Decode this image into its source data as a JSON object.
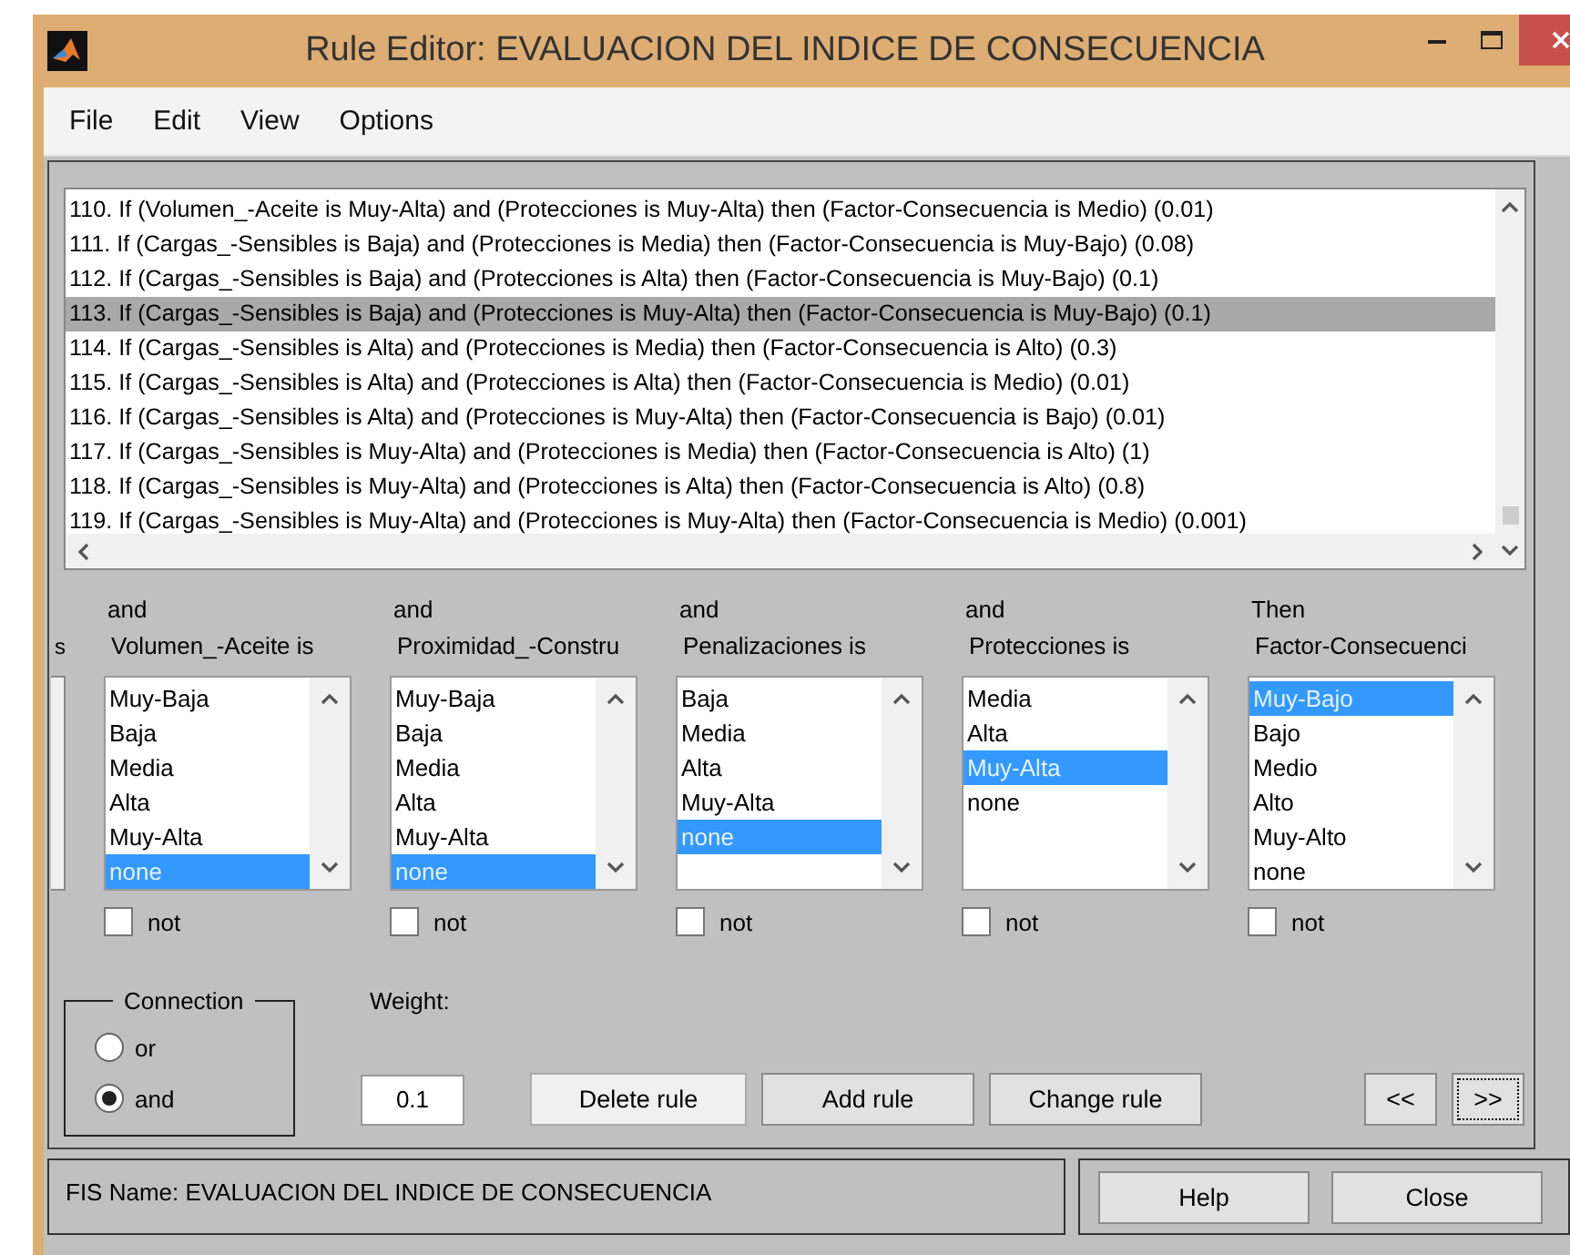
{
  "window": {
    "title": "Rule Editor: EVALUACION DEL INDICE DE CONSECUENCIA"
  },
  "menu": [
    "File",
    "Edit",
    "View",
    "Options"
  ],
  "rules": [
    {
      "text": "110. If (Volumen_-Aceite is Muy-Alta) and (Protecciones is Muy-Alta) then (Factor-Consecuencia is Medio) (0.01)",
      "selected": false
    },
    {
      "text": "111. If (Cargas_-Sensibles is Baja) and (Protecciones is Media) then (Factor-Consecuencia is Muy-Bajo) (0.08)",
      "selected": false
    },
    {
      "text": "112. If (Cargas_-Sensibles is Baja) and (Protecciones is Alta) then (Factor-Consecuencia is Muy-Bajo) (0.1)",
      "selected": false
    },
    {
      "text": "113. If (Cargas_-Sensibles is Baja) and (Protecciones is Muy-Alta) then (Factor-Consecuencia is Muy-Bajo) (0.1)",
      "selected": true
    },
    {
      "text": "114. If (Cargas_-Sensibles is Alta) and (Protecciones is Media) then (Factor-Consecuencia is Alto) (0.3)",
      "selected": false
    },
    {
      "text": "115. If (Cargas_-Sensibles is Alta) and (Protecciones is Alta) then (Factor-Consecuencia is Medio) (0.01)",
      "selected": false
    },
    {
      "text": "116. If (Cargas_-Sensibles is Alta) and (Protecciones is Muy-Alta) then (Factor-Consecuencia is Bajo) (0.01)",
      "selected": false
    },
    {
      "text": "117. If (Cargas_-Sensibles is Muy-Alta) and (Protecciones is Media) then (Factor-Consecuencia is Alto) (1)",
      "selected": false
    },
    {
      "text": "118. If (Cargas_-Sensibles is Muy-Alta) and (Protecciones is Alta) then (Factor-Consecuencia is Alto) (0.8)",
      "selected": false
    },
    {
      "text": "119. If (Cargas_-Sensibles is Muy-Alta) and (Protecciones is Muy-Alta) then (Factor-Consecuencia is Medio) (0.001)",
      "selected": false
    }
  ],
  "partial_column": {
    "label": "s"
  },
  "columns": [
    {
      "connector": "and",
      "label": "Volumen_-Aceite is",
      "not": false,
      "items": [
        {
          "label": "Muy-Baja",
          "selected": false
        },
        {
          "label": "Baja",
          "selected": false
        },
        {
          "label": "Media",
          "selected": false
        },
        {
          "label": "Alta",
          "selected": false
        },
        {
          "label": "Muy-Alta",
          "selected": false
        },
        {
          "label": "none",
          "selected": true
        }
      ]
    },
    {
      "connector": "and",
      "label": "Proximidad_-Constru",
      "not": false,
      "items": [
        {
          "label": "Muy-Baja",
          "selected": false
        },
        {
          "label": "Baja",
          "selected": false
        },
        {
          "label": "Media",
          "selected": false
        },
        {
          "label": "Alta",
          "selected": false
        },
        {
          "label": "Muy-Alta",
          "selected": false
        },
        {
          "label": "none",
          "selected": true
        }
      ]
    },
    {
      "connector": "and",
      "label": "Penalizaciones is",
      "not": false,
      "items": [
        {
          "label": "Baja",
          "selected": false
        },
        {
          "label": "Media",
          "selected": false
        },
        {
          "label": "Alta",
          "selected": false
        },
        {
          "label": "Muy-Alta",
          "selected": false
        },
        {
          "label": "none",
          "selected": true
        }
      ]
    },
    {
      "connector": "and",
      "label": "Protecciones is",
      "not": false,
      "items": [
        {
          "label": "Media",
          "selected": false
        },
        {
          "label": "Alta",
          "selected": false
        },
        {
          "label": "Muy-Alta",
          "selected": true
        },
        {
          "label": "none",
          "selected": false
        }
      ]
    },
    {
      "connector": "Then",
      "label": "Factor-Consecuenci",
      "not": false,
      "items": [
        {
          "label": "Muy-Bajo",
          "selected": true
        },
        {
          "label": "Bajo",
          "selected": false
        },
        {
          "label": "Medio",
          "selected": false
        },
        {
          "label": "Alto",
          "selected": false
        },
        {
          "label": "Muy-Alto",
          "selected": false
        },
        {
          "label": "none",
          "selected": false
        }
      ]
    }
  ],
  "not_labels": [
    "not",
    "not",
    "not",
    "not",
    "not"
  ],
  "connection": {
    "title": "Connection",
    "options": [
      {
        "label": "or",
        "selected": false
      },
      {
        "label": "and",
        "selected": true
      }
    ]
  },
  "weight": {
    "label": "Weight:",
    "value": "0.1"
  },
  "buttons": [
    {
      "label": "Delete rule",
      "highlighted": true,
      "focused": false
    },
    {
      "label": "Add rule",
      "highlighted": false,
      "focused": false
    },
    {
      "label": "Change rule",
      "highlighted": false,
      "focused": false
    }
  ],
  "nav_buttons": [
    {
      "label": "<<",
      "focused": false
    },
    {
      "label": ">>",
      "focused": true
    }
  ],
  "status": {
    "text": "FIS Name: EVALUACION DEL INDICE DE CONSECUENCIA"
  },
  "footer_buttons": [
    "Help",
    "Close"
  ]
}
